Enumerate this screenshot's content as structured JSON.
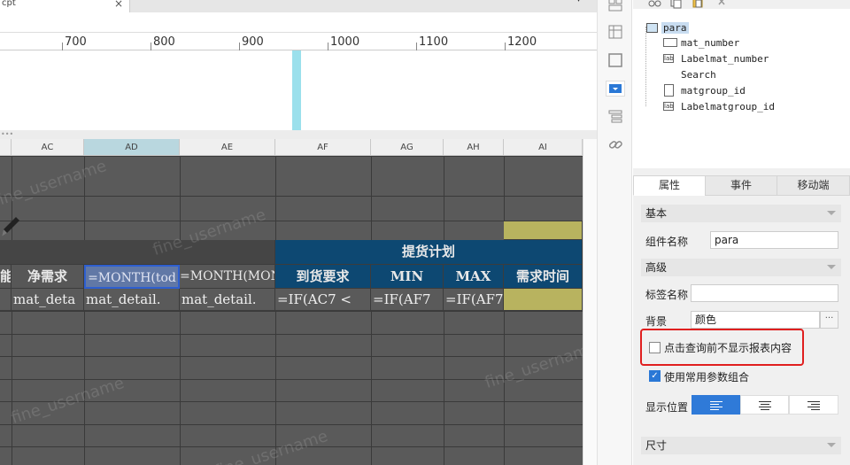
{
  "tab": {
    "title": "cpt",
    "close": "×"
  },
  "ruler": {
    "labels": [
      "700",
      "800",
      "900",
      "1000",
      "1100",
      "1200"
    ]
  },
  "divider": {
    "grip": "•••"
  },
  "sheet": {
    "columns": [
      "AC",
      "AD",
      "AE",
      "AF",
      "AG",
      "AH",
      "AI"
    ],
    "selected_column": "AD",
    "merged_header": "提货计划",
    "headers": [
      "能",
      "净需求",
      "=MONTH(tod",
      "=MONTH(MON",
      "到货要求",
      "MIN",
      "MAX",
      "需求时间"
    ],
    "formulas": [
      "",
      "mat_deta",
      "mat_detail.",
      "mat_detail.",
      "=IF(AC7 <",
      "=IF(AF7",
      "=IF(AF7",
      ""
    ],
    "watermark": "fine_username"
  },
  "toolbar": {
    "icons": [
      "layout-icon",
      "report-icon",
      "frame-icon",
      "dropdown-icon",
      "list-icon",
      "link-icon"
    ],
    "active": "dropdown-icon"
  },
  "tree": {
    "items": [
      {
        "name": "para",
        "icon": "form-icon",
        "selected": true
      },
      {
        "name": "mat_number",
        "icon": "textfield-icon"
      },
      {
        "name": "Labelmat_number",
        "icon": "lab"
      },
      {
        "name": "Search",
        "icon": ""
      },
      {
        "name": "matgroup_id",
        "icon": "combo-icon"
      },
      {
        "name": "Labelmatgroup_id",
        "icon": "lab"
      }
    ]
  },
  "panel_tabs": [
    "属性",
    "事件",
    "移动端"
  ],
  "panel_active_tab": "属性",
  "props": {
    "basic_section": "基本",
    "component_name_label": "组件名称",
    "component_name_value": "para",
    "advanced_section": "高级",
    "tag_name_label": "标签名称",
    "tag_name_value": "",
    "background_label": "背景",
    "background_value": "颜色",
    "background_more": "···",
    "hide_before_query_label": "点击查询前不显示报表内容",
    "hide_before_query_checked": false,
    "use_common_params_label": "使用常用参数组合",
    "use_common_params_checked": true,
    "display_position_label": "显示位置",
    "display_position_options": [
      "left-align-icon",
      "center-align-icon",
      "right-align-icon"
    ],
    "display_position_selected": "left-align-icon",
    "size_section": "尺寸"
  }
}
